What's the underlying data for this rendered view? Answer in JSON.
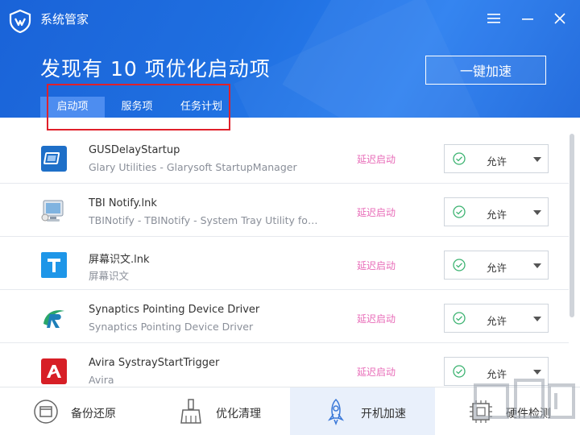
{
  "app": {
    "title": "系统管家"
  },
  "header": {
    "headline": "发现有 10 项优化启动项",
    "boost_button": "一键加速"
  },
  "tabs": [
    {
      "label": "启动项",
      "active": true
    },
    {
      "label": "服务项",
      "active": false
    },
    {
      "label": "任务计划",
      "active": false
    }
  ],
  "rows": [
    {
      "icon": "gusdelay-icon",
      "name": "GUSDelayStartup",
      "desc": "Glary Utilities - Glarysoft StartupManager",
      "action": "延迟启动",
      "status": "允许"
    },
    {
      "icon": "tbi-notify-icon",
      "name": "TBI Notify.lnk",
      "desc": "TBINotify - TBINotify - System Tray Utility for T...",
      "action": "延迟启动",
      "status": "允许"
    },
    {
      "icon": "screen-ocr-icon",
      "name": "屏幕识文.lnk",
      "desc": "屏幕识文",
      "action": "延迟启动",
      "status": "允许"
    },
    {
      "icon": "synaptics-icon",
      "name": "Synaptics Pointing Device Driver",
      "desc": "Synaptics Pointing Device Driver",
      "action": "延迟启动",
      "status": "允许"
    },
    {
      "icon": "avira-icon",
      "name": "Avira SystrayStartTrigger",
      "desc": "Avira",
      "action": "延迟启动",
      "status": "允许"
    }
  ],
  "bottom_nav": [
    {
      "label": "备份还原",
      "icon": "backup-restore-icon",
      "active": false
    },
    {
      "label": "优化清理",
      "icon": "broom-icon",
      "active": false
    },
    {
      "label": "开机加速",
      "icon": "rocket-icon",
      "active": true
    },
    {
      "label": "硬件检测",
      "icon": "chip-icon",
      "active": false
    }
  ],
  "colors": {
    "header_blue": "#1f6fe0",
    "tab_active": "#4d8df0",
    "delay_pink": "#e86cb8",
    "check_green": "#3cb371",
    "highlight_red": "#e0202a"
  }
}
